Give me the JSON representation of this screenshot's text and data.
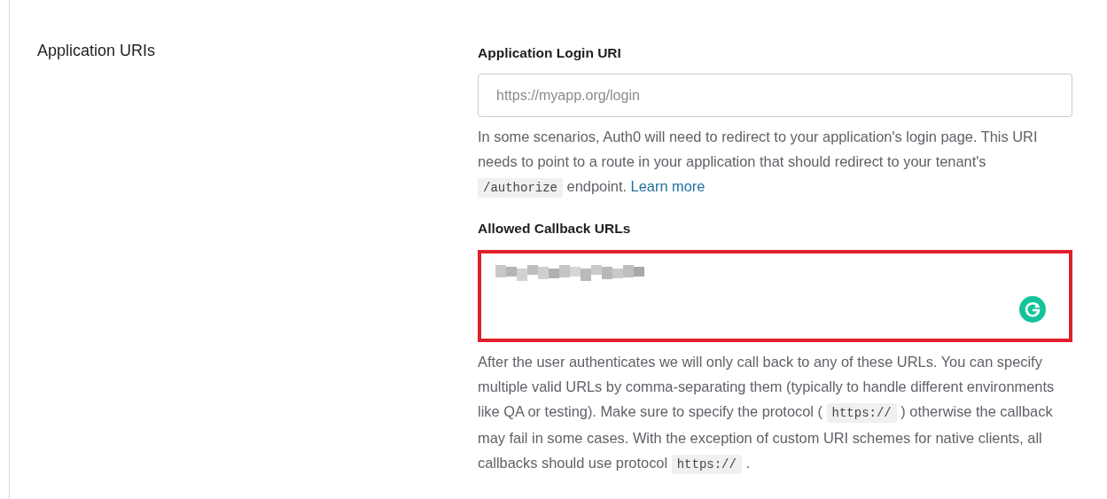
{
  "section": {
    "title": "Application URIs"
  },
  "fields": [
    {
      "kind": "input",
      "label": "Application Login URI",
      "placeholder": "https://myapp.org/login",
      "highlighted": false,
      "help": [
        {
          "kind": "text",
          "text": "In some scenarios, Auth0 will need to redirect to your application's login page. This URI needs to point to a route in your application that should redirect to your tenant's "
        },
        {
          "kind": "code",
          "text": "/authorize"
        },
        {
          "kind": "text",
          "text": " endpoint. "
        },
        {
          "kind": "link",
          "text": "Learn more"
        }
      ]
    },
    {
      "kind": "textarea",
      "label": "Allowed Callback URLs",
      "highlighted": true,
      "value_redacted": true,
      "grammar_badge": true,
      "help": [
        {
          "kind": "text",
          "text": "After the user authenticates we will only call back to any of these URLs. You can specify multiple valid URLs by comma-separating them (typically to handle different environments like QA or testing). Make sure to specify the protocol ( "
        },
        {
          "kind": "code",
          "text": "https://"
        },
        {
          "kind": "text",
          "text": " ) otherwise the callback may fail in some cases. With the exception of custom URI schemes for native clients, all callbacks should use protocol "
        },
        {
          "kind": "code",
          "text": "https://"
        },
        {
          "kind": "text",
          "text": " ."
        }
      ]
    }
  ]
}
